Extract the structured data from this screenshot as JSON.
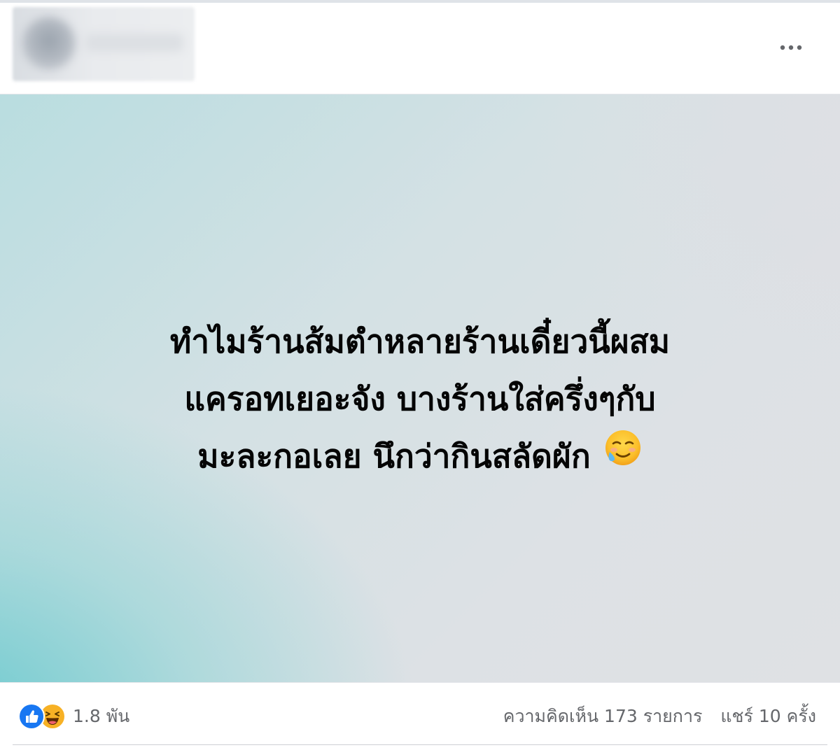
{
  "post": {
    "author": {
      "avatar_icon": "blurred-avatar",
      "name": ""
    },
    "menu_icon": "more-horizontal-icon",
    "text_lines": [
      "ทำไมร้านส้มตำหลายร้านเดี๋ยวนี้ผสม",
      "แครอทเยอะจัง บางร้านใส่ครึ่งๆกับ",
      "มะละกอเลย นึกว่ากินสลัดผัก"
    ],
    "text_emoji_icon": "face-holding-back-tears-icon",
    "background_colors": {
      "teal": "#8fd3d6",
      "gray": "#dfe1e4"
    }
  },
  "footer": {
    "reaction_icons": [
      "like-icon",
      "haha-icon"
    ],
    "reaction_count": "1.8 พัน",
    "comments": "ความคิดเห็น 173 รายการ",
    "shares": "แชร์ 10 ครั้ง"
  },
  "colors": {
    "like_blue": "#1877f2",
    "haha_yellow": "#f7b125",
    "secondary_text": "#65676b",
    "primary_text": "#050505"
  }
}
